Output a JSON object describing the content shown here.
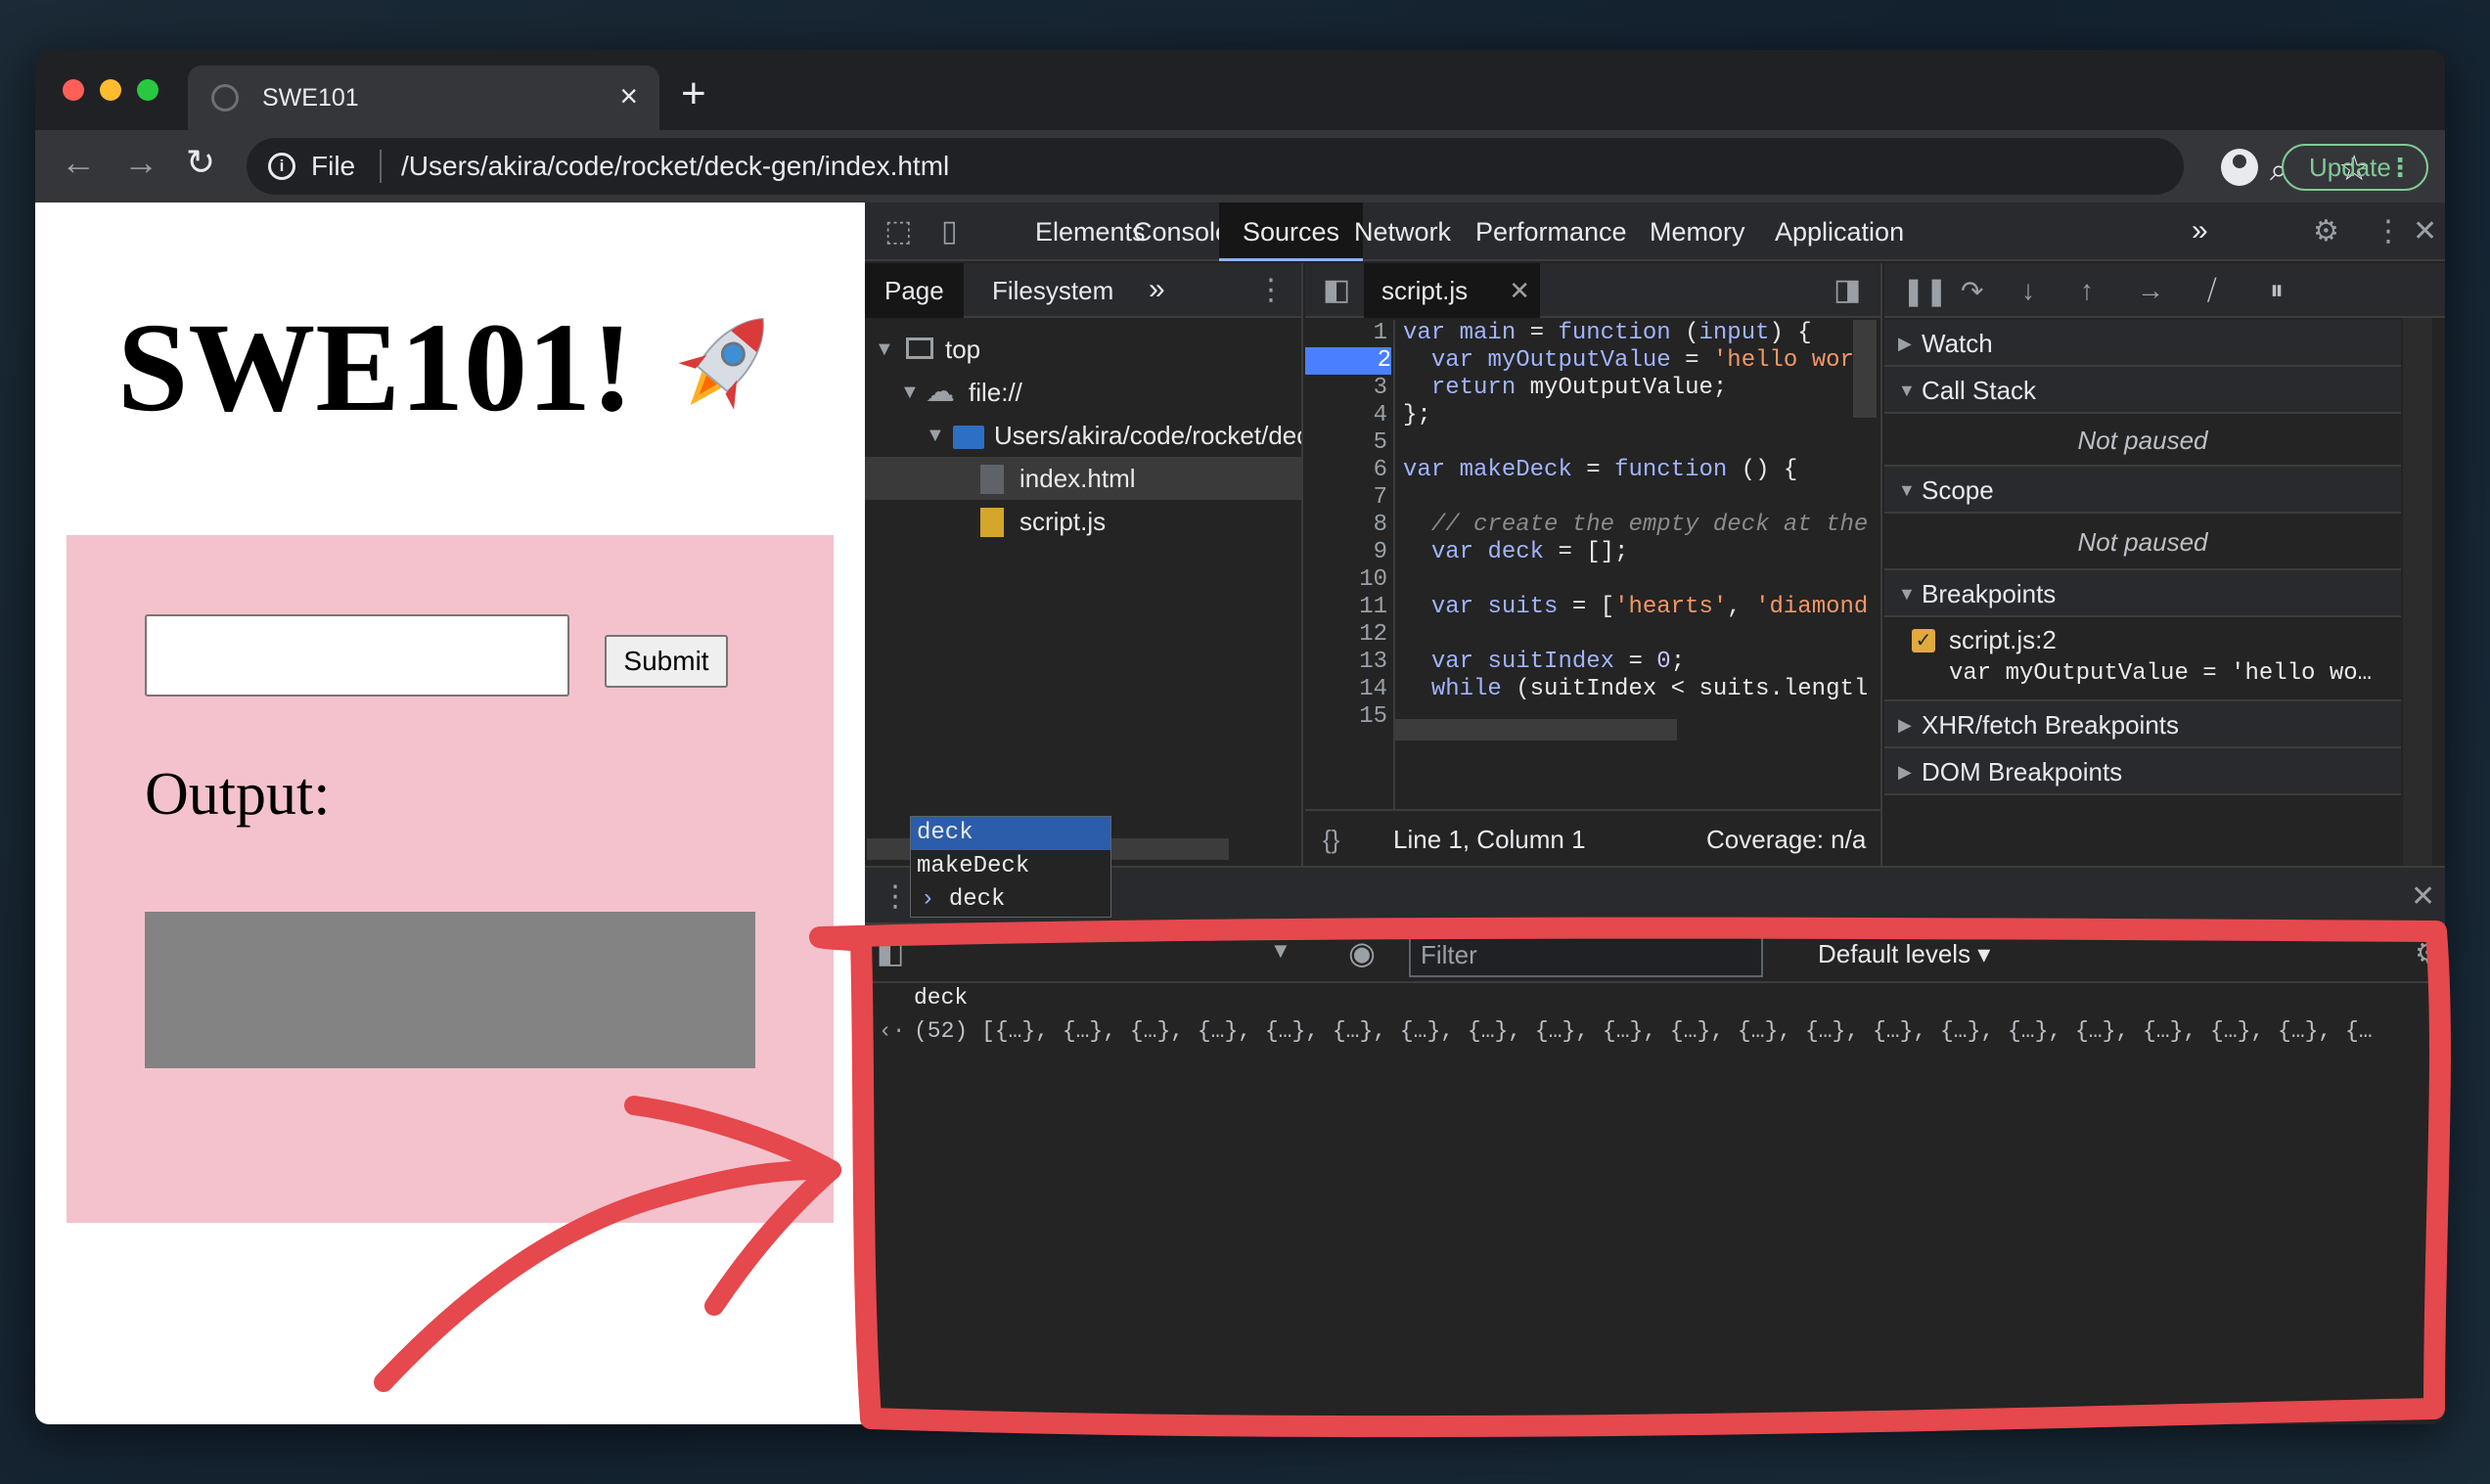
{
  "browser": {
    "tab_title": "SWE101",
    "url_scheme": "File",
    "url_path": "/Users/akira/code/rocket/deck-gen/index.html",
    "update_label": "Update"
  },
  "page": {
    "heading": "SWE101!",
    "submit_label": "Submit",
    "output_label": "Output:",
    "input_value": ""
  },
  "devtools": {
    "tabs": [
      "Elements",
      "Console",
      "Sources",
      "Network",
      "Performance",
      "Memory",
      "Application"
    ],
    "active_tab": "Sources",
    "navigator": {
      "subtabs": [
        "Page",
        "Filesystem"
      ],
      "tree": [
        "top",
        "file://",
        "Users/akira/code/rocket/deck-gen",
        "index.html",
        "script.js"
      ]
    },
    "editor": {
      "file_tab": "script.js",
      "status_position": "Line 1, Column 1",
      "status_coverage": "Coverage: n/a"
    },
    "debugger": {
      "sections": [
        "Watch",
        "Call Stack",
        "Scope",
        "Breakpoints",
        "XHR/fetch Breakpoints",
        "DOM Breakpoints"
      ],
      "not_paused": "Not paused",
      "breakpoint_file": "script.js:2",
      "breakpoint_code": "var myOutputValue = 'hello wo…"
    },
    "console": {
      "filter_placeholder": "Filter",
      "levels": "Default levels",
      "input_text": "deck",
      "result": "(52) [{…}, {…}, {…}, {…}, {…}, {…}, {…}, {…}, {…}, {…}, {…}, {…}, {…}, {…}, {…}, {…}, {…}, {…}, {…}, {…}, {…",
      "autocomplete": [
        "deck",
        "makeDeck",
        "deck"
      ]
    }
  },
  "code_lines": [
    "1",
    "2",
    "3",
    "4",
    "5",
    "6",
    "7",
    "8",
    "9",
    "10",
    "11",
    "12",
    "13",
    "14",
    "15"
  ],
  "colors": {
    "annotation": "#e5484d",
    "pink_box": "#f4c2cc",
    "output_box": "#838383"
  }
}
